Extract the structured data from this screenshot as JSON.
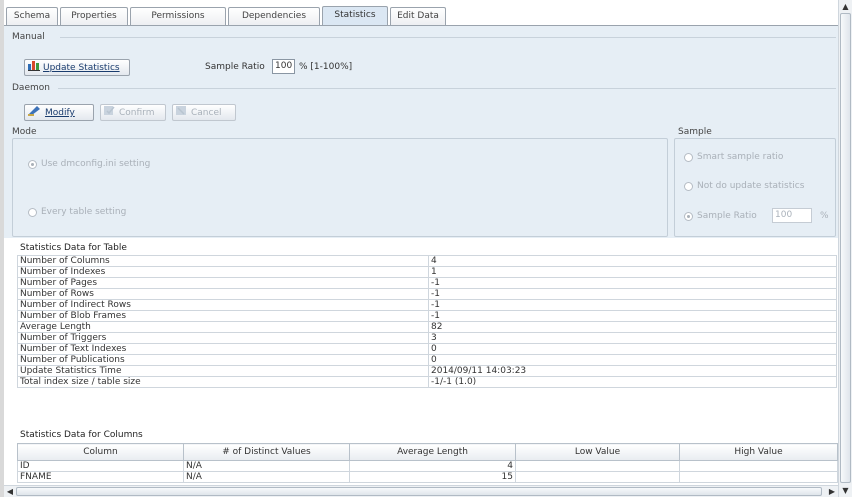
{
  "tabs": [
    "Schema",
    "Properties",
    "Permissions",
    "Dependencies",
    "Statistics",
    "Edit Data"
  ],
  "manual": {
    "label": "Manual",
    "update_button": "Update Statistics",
    "sample_ratio_label": "Sample Ratio",
    "sample_ratio_value": "100",
    "sample_ratio_suffix": "% [1-100%]"
  },
  "daemon": {
    "label": "Daemon",
    "modify": "Modify",
    "confirm": "Confirm",
    "cancel": "Cancel"
  },
  "mode": {
    "label": "Mode",
    "option1": "Use dmconfig.ini setting",
    "option2": "Every table setting"
  },
  "sample": {
    "label": "Sample",
    "option1": "Smart sample ratio",
    "option2": "Not do update statistics",
    "option3": "Sample Ratio",
    "ratio_value": "100",
    "ratio_suffix": "%"
  },
  "table_stats": {
    "title": "Statistics Data for Table",
    "rows": [
      {
        "k": "Number of Columns",
        "v": "4"
      },
      {
        "k": "Number of Indexes",
        "v": "1"
      },
      {
        "k": "Number of Pages",
        "v": "-1"
      },
      {
        "k": "Number of Rows",
        "v": "-1"
      },
      {
        "k": "Number of Indirect Rows",
        "v": "-1"
      },
      {
        "k": "Number of Blob Frames",
        "v": "-1"
      },
      {
        "k": "Average Length",
        "v": "82"
      },
      {
        "k": "Number of Triggers",
        "v": "3"
      },
      {
        "k": "Number of Text Indexes",
        "v": "0"
      },
      {
        "k": "Number of Publications",
        "v": "0"
      },
      {
        "k": "Update Statistics Time",
        "v": "2014/09/11 14:03:23"
      },
      {
        "k": "Total index size / table size",
        "v": "-1/-1 (1.0)"
      }
    ]
  },
  "column_stats": {
    "title": "Statistics Data for Columns",
    "headers": [
      "Column",
      "# of Distinct Values",
      "Average Length",
      "Low Value",
      "High Value"
    ],
    "rows": [
      {
        "c1": "ID",
        "c2": "N/A",
        "c3": "4",
        "c4": "",
        "c5": ""
      },
      {
        "c1": "FNAME",
        "c2": "N/A",
        "c3": "15",
        "c4": "",
        "c5": ""
      }
    ]
  },
  "colors": {
    "panel_bg": "#e6eef5",
    "active_tab": "#dbe7f3",
    "button_text": "#1a3c6e",
    "disabled_text": "#a9b1ba"
  },
  "icons": {
    "update": "bar-chart-icon",
    "modify": "modify-icon",
    "confirm": "confirm-icon",
    "cancel": "cancel-icon"
  }
}
